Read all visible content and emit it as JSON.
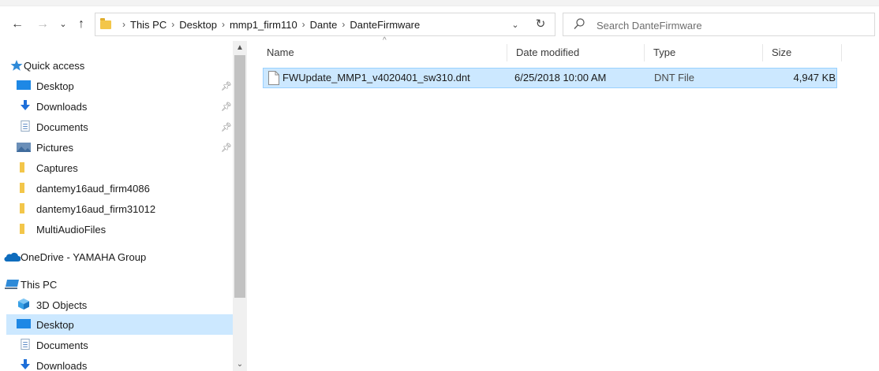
{
  "breadcrumb": [
    "This PC",
    "Desktop",
    "mmp1_firm110",
    "Dante",
    "DanteFirmware"
  ],
  "search": {
    "placeholder": "Search DanteFirmware"
  },
  "nav": {
    "quick_access": "Quick access",
    "items": [
      {
        "label": "Desktop",
        "icon": "desktop-icon",
        "pinned": true
      },
      {
        "label": "Downloads",
        "icon": "downloads-icon",
        "pinned": true
      },
      {
        "label": "Documents",
        "icon": "documents-icon",
        "pinned": true
      },
      {
        "label": "Pictures",
        "icon": "pictures-icon",
        "pinned": true
      },
      {
        "label": "Captures",
        "icon": "folder-icon"
      },
      {
        "label": "dantemy16aud_firm4086",
        "icon": "folder-icon"
      },
      {
        "label": "dantemy16aud_firm31012",
        "icon": "folder-icon"
      },
      {
        "label": "MultiAudioFiles",
        "icon": "folder-icon"
      }
    ],
    "onedrive": "OneDrive - YAMAHA Group",
    "this_pc": "This PC",
    "pc_items": [
      {
        "label": "3D Objects",
        "icon": "3d-objects-icon"
      },
      {
        "label": "Desktop",
        "icon": "desktop-icon",
        "selected": true
      },
      {
        "label": "Documents",
        "icon": "documents-icon"
      },
      {
        "label": "Downloads",
        "icon": "downloads-icon"
      }
    ]
  },
  "columns": {
    "name": "Name",
    "date": "Date modified",
    "type": "Type",
    "size": "Size"
  },
  "files": [
    {
      "name": "FWUpdate_MMP1_v4020401_sw310.dnt",
      "date": "6/25/2018 10:00 AM",
      "type": "DNT File",
      "size": "4,947 KB"
    }
  ],
  "colors": {
    "selection": "#cce8ff",
    "selection_border": "#99d1ff",
    "folder": "#f3c64a",
    "accent": "#0078d7"
  }
}
